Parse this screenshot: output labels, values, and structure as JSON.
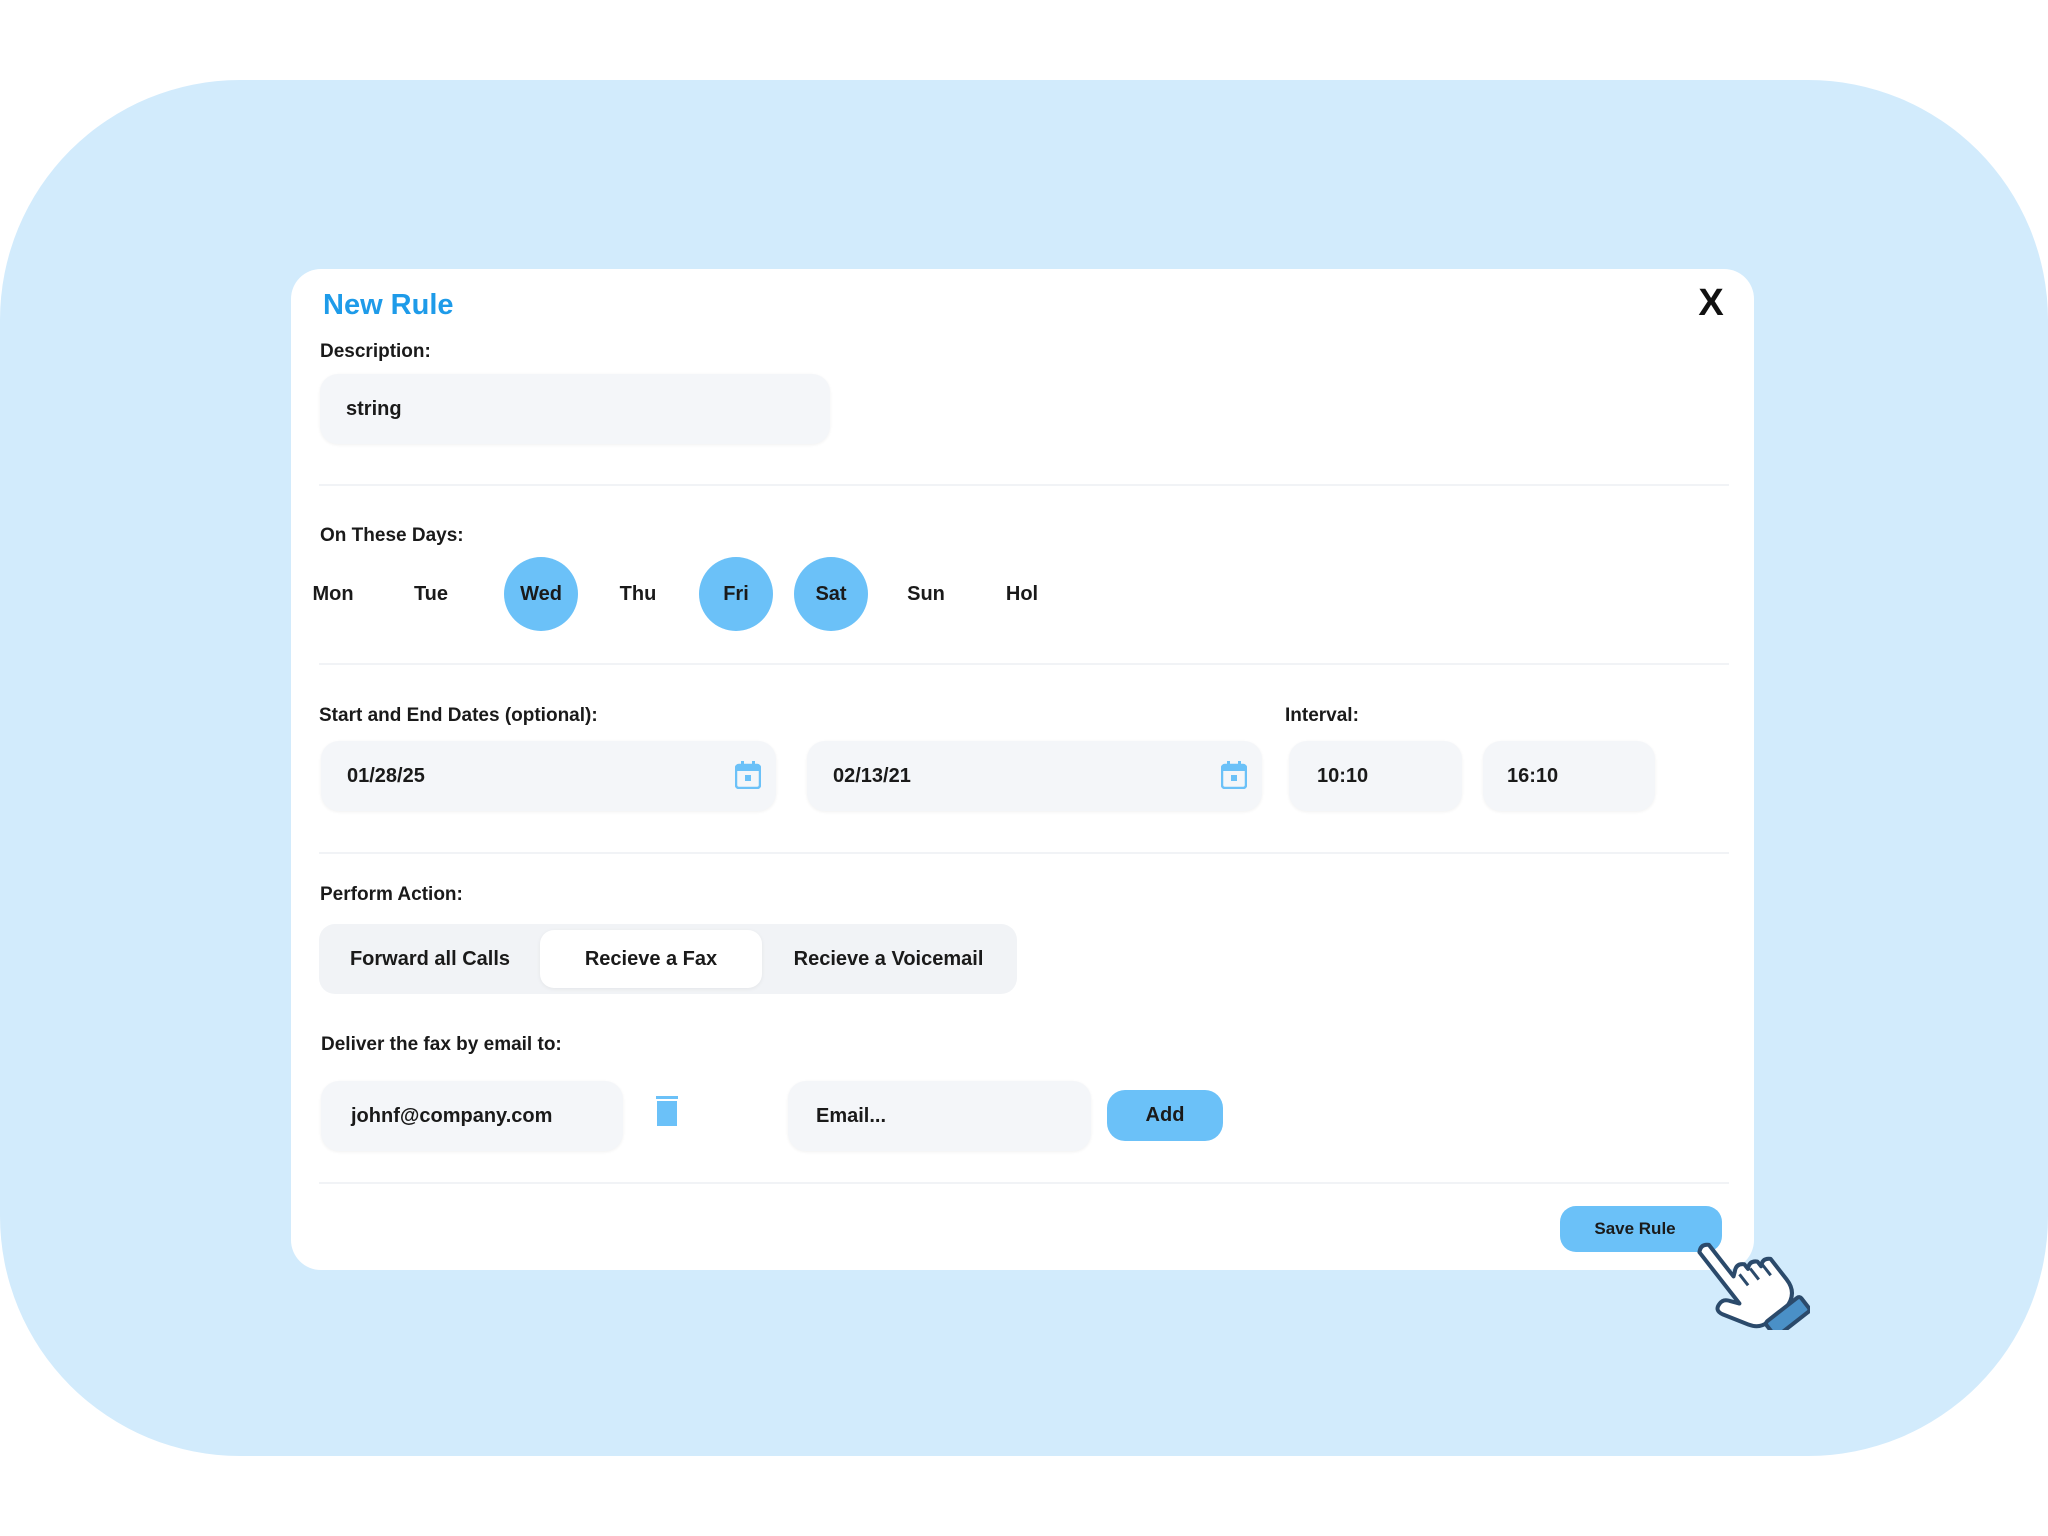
{
  "modal": {
    "title": "New Rule",
    "close_label": "X"
  },
  "description": {
    "label": "Description:",
    "value": "string"
  },
  "days": {
    "label": "On These Days:",
    "items": [
      {
        "label": "Mon",
        "selected": false
      },
      {
        "label": "Tue",
        "selected": false
      },
      {
        "label": "Wed",
        "selected": true
      },
      {
        "label": "Thu",
        "selected": false
      },
      {
        "label": "Fri",
        "selected": true
      },
      {
        "label": "Sat",
        "selected": true
      },
      {
        "label": "Sun",
        "selected": false
      },
      {
        "label": "Hol",
        "selected": false
      }
    ]
  },
  "dates": {
    "label": "Start and End Dates (optional):",
    "start": "01/28/25",
    "end": "02/13/21",
    "icon": "calendar-icon"
  },
  "interval": {
    "label": "Interval:",
    "from": "10:10",
    "to": "16:10"
  },
  "action": {
    "label": "Perform Action:",
    "options": [
      "Forward all Calls",
      "Recieve a Fax",
      "Recieve a Voicemail"
    ],
    "selected": "Recieve a Fax"
  },
  "delivery": {
    "label": "Deliver the fax by email to:",
    "email": "johnf@company.com",
    "placeholder": "Email...",
    "add_label": "Add",
    "icon": "trash-icon"
  },
  "footer": {
    "save_label": "Save Rule"
  },
  "colors": {
    "accent": "#6bc1f8",
    "title": "#1e9be9",
    "backdrop": "#d2ebfc"
  }
}
